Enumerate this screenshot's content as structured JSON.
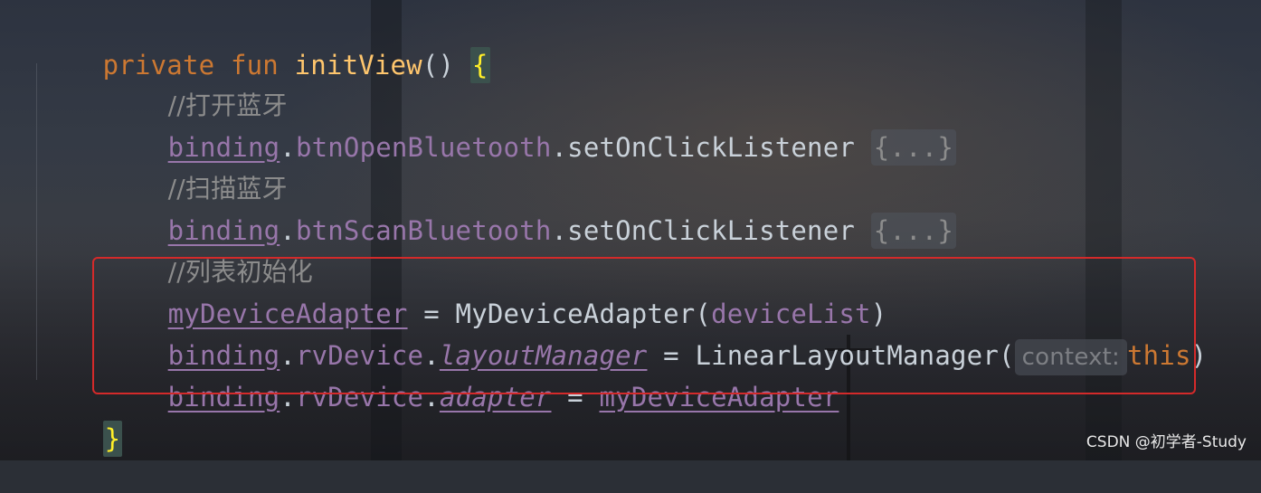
{
  "code": {
    "line1": {
      "kw1": "private",
      "kw2": "fun",
      "fn": "initView",
      "paren": "()",
      "brace": "{"
    },
    "line2": {
      "comment": "//打开蓝牙"
    },
    "line3": {
      "obj": "binding",
      "dot": ".",
      "prop": "btnOpenBluetooth",
      "rest": ".setOnClickListener",
      "fold": "{...}"
    },
    "line4": {
      "comment": "//扫描蓝牙"
    },
    "line5": {
      "obj": "binding",
      "dot": ".",
      "prop": "btnScanBluetooth",
      "rest": ".setOnClickListener",
      "fold": "{...}"
    },
    "line6": {
      "comment": "//列表初始化"
    },
    "line7": {
      "var": "myDeviceAdapter",
      "eq": " = ",
      "cls": "MyDeviceAdapter(",
      "arg": "deviceList",
      "close": ")"
    },
    "line8": {
      "obj": "binding",
      "dot": ".",
      "prop": "rvDevice",
      "dot2": ".",
      "member": "layoutManager",
      "eq": " = ",
      "cls": "LinearLayoutManager(",
      "hint": "context:",
      "arg": "this",
      "close": ")"
    },
    "line9": {
      "obj": "binding",
      "dot": ".",
      "prop": "rvDevice",
      "dot2": ".",
      "member": "adapter",
      "eq": " = ",
      "val": "myDeviceAdapter"
    },
    "line10": {
      "brace": "}"
    }
  },
  "watermark": "CSDN @初学者-Study",
  "colors": {
    "keyword": "#cc7832",
    "function": "#ffc66d",
    "property": "#9876aa",
    "comment": "#8c8c8c",
    "highlight_box": "#d42a2a"
  }
}
